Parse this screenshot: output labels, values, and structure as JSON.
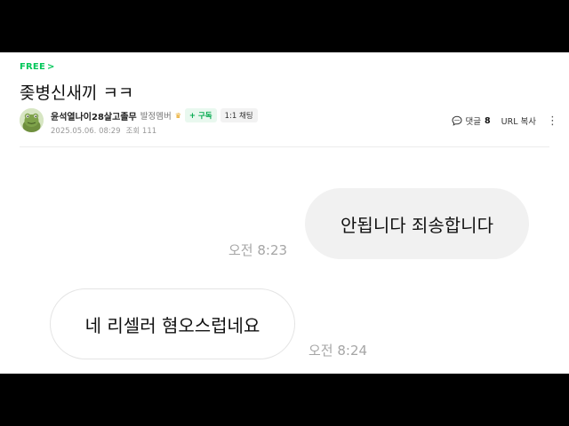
{
  "post": {
    "board_label": "FREE",
    "board_chevron": ">",
    "title": "좆병신새끼 ㅋㅋ"
  },
  "author": {
    "name": "윤석열나이28살고졸무",
    "grade": "발정멤버",
    "grade_icon": "crown-icon",
    "subscribe_label": "+ 구독",
    "chat_label": "1:1 채팅"
  },
  "meta": {
    "date": "2025.05.06. 08:29",
    "views": "조회 111"
  },
  "actions": {
    "comment_label": "댓글",
    "comment_count": "8",
    "url_copy_label": "URL 복사",
    "more_icon": "more-vertical-icon"
  },
  "chat": {
    "messages": [
      {
        "text": "안됩니다 죄송합니다",
        "time": "오전 8:23",
        "side": "right"
      },
      {
        "text": "네 리셀러 혐오스럽네요",
        "time": "오전 8:24",
        "side": "left"
      }
    ]
  },
  "colors": {
    "accent_green": "#03c75a",
    "bubble_gray": "#f1f1f1",
    "letterbox": "#000000"
  }
}
